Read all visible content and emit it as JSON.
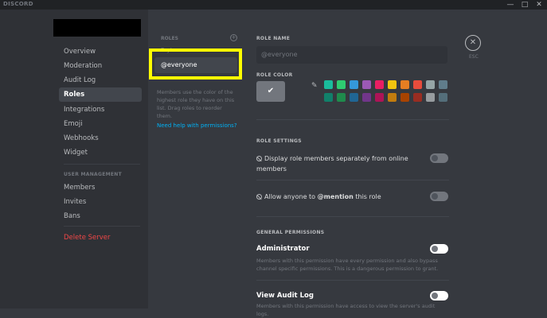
{
  "titlebar": {
    "brand": "DISCORD",
    "minimize": "—",
    "maximize": "□",
    "close": "✕"
  },
  "sidebar": {
    "items": [
      {
        "label": "Overview"
      },
      {
        "label": "Moderation"
      },
      {
        "label": "Audit Log"
      },
      {
        "label": "Roles"
      },
      {
        "label": "Integrations"
      },
      {
        "label": "Emoji"
      },
      {
        "label": "Webhooks"
      },
      {
        "label": "Widget"
      }
    ],
    "user_management_header": "USER MANAGEMENT",
    "user_items": [
      {
        "label": "Members"
      },
      {
        "label": "Invites"
      },
      {
        "label": "Bans"
      }
    ],
    "delete_label": "Delete Server"
  },
  "roles_panel": {
    "header": "ROLES",
    "hidden_role": "Bryte",
    "selected_role": "@everyone",
    "help_text": "Members use the color of the highest role they have on this list. Drag roles to reorder them.",
    "help_link": "Need help with permissions?"
  },
  "editor": {
    "role_name_label": "ROLE NAME",
    "role_name_value": "@everyone",
    "role_color_label": "ROLE COLOR",
    "swatches_row1": [
      "#1abc9c",
      "#2ecc71",
      "#3498db",
      "#9b59b6",
      "#e91e63",
      "#f1c40f",
      "#e67e22",
      "#e74c3c",
      "#95a5a6",
      "#607d8b"
    ],
    "swatches_row2": [
      "#11806a",
      "#1f8b4c",
      "#206694",
      "#71368a",
      "#ad1457",
      "#c27c0e",
      "#a84300",
      "#992d22",
      "#979c9f",
      "#546e7a"
    ],
    "role_settings_label": "ROLE SETTINGS",
    "setting_display": "Display role members separately from online members",
    "setting_mention_prefix": "Allow anyone to ",
    "setting_mention_bold": "@mention",
    "setting_mention_suffix": " this role",
    "general_permissions_label": "GENERAL PERMISSIONS",
    "perm_admin_title": "Administrator",
    "perm_admin_desc": "Members with this permission have every permission and also bypass channel specific permissions. This is a dangerous permission to grant.",
    "perm_audit_title": "View Audit Log",
    "perm_audit_desc": "Members with this permission have access to view the server's audit logs."
  },
  "esc": {
    "icon": "✕",
    "label": "ESC"
  },
  "colors": {
    "accent_highlight": "#ffff00",
    "link": "#00b0f4",
    "danger": "#f04747"
  }
}
